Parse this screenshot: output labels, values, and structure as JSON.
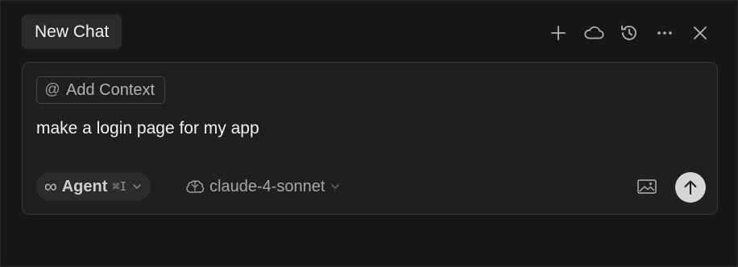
{
  "header": {
    "tab_title": "New Chat",
    "actions": [
      {
        "name": "new-chat-button",
        "icon": "plus-icon"
      },
      {
        "name": "cloud-button",
        "icon": "cloud-icon"
      },
      {
        "name": "history-button",
        "icon": "history-icon"
      },
      {
        "name": "more-button",
        "icon": "ellipsis-icon"
      },
      {
        "name": "close-button",
        "icon": "close-icon"
      }
    ]
  },
  "composer": {
    "context_chip": {
      "symbol": "@",
      "label": "Add Context"
    },
    "prompt_text": "make a login page for my app",
    "mode": {
      "icon": "infinity-icon",
      "symbol": "∞",
      "label": "Agent",
      "shortcut": "⌘I"
    },
    "model": {
      "icon": "brain-icon",
      "label": "claude-4-sonnet"
    },
    "image_button": {
      "icon": "image-icon"
    },
    "send_button": {
      "icon": "arrow-up-icon"
    }
  },
  "colors": {
    "background": "#171717",
    "composer_bg": "#1f1f1f",
    "tab_bg": "#2a2a2a",
    "send_bg": "#d6d6d6"
  }
}
